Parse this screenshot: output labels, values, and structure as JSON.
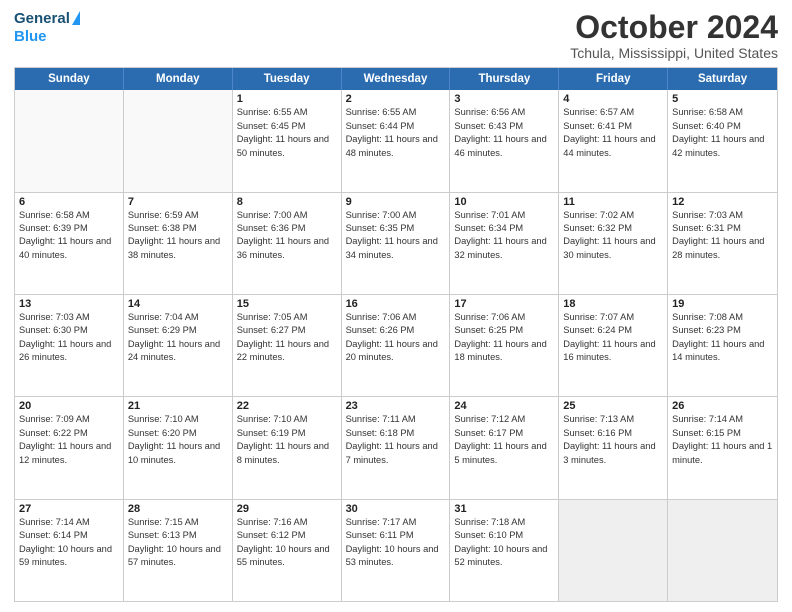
{
  "header": {
    "logo_general": "General",
    "logo_blue": "Blue",
    "month_title": "October 2024",
    "location": "Tchula, Mississippi, United States"
  },
  "weekdays": [
    "Sunday",
    "Monday",
    "Tuesday",
    "Wednesday",
    "Thursday",
    "Friday",
    "Saturday"
  ],
  "weeks": [
    [
      {
        "day": "",
        "info": "",
        "empty": true
      },
      {
        "day": "",
        "info": "",
        "empty": true
      },
      {
        "day": "1",
        "info": "Sunrise: 6:55 AM\nSunset: 6:45 PM\nDaylight: 11 hours and 50 minutes."
      },
      {
        "day": "2",
        "info": "Sunrise: 6:55 AM\nSunset: 6:44 PM\nDaylight: 11 hours and 48 minutes."
      },
      {
        "day": "3",
        "info": "Sunrise: 6:56 AM\nSunset: 6:43 PM\nDaylight: 11 hours and 46 minutes."
      },
      {
        "day": "4",
        "info": "Sunrise: 6:57 AM\nSunset: 6:41 PM\nDaylight: 11 hours and 44 minutes."
      },
      {
        "day": "5",
        "info": "Sunrise: 6:58 AM\nSunset: 6:40 PM\nDaylight: 11 hours and 42 minutes."
      }
    ],
    [
      {
        "day": "6",
        "info": "Sunrise: 6:58 AM\nSunset: 6:39 PM\nDaylight: 11 hours and 40 minutes."
      },
      {
        "day": "7",
        "info": "Sunrise: 6:59 AM\nSunset: 6:38 PM\nDaylight: 11 hours and 38 minutes."
      },
      {
        "day": "8",
        "info": "Sunrise: 7:00 AM\nSunset: 6:36 PM\nDaylight: 11 hours and 36 minutes."
      },
      {
        "day": "9",
        "info": "Sunrise: 7:00 AM\nSunset: 6:35 PM\nDaylight: 11 hours and 34 minutes."
      },
      {
        "day": "10",
        "info": "Sunrise: 7:01 AM\nSunset: 6:34 PM\nDaylight: 11 hours and 32 minutes."
      },
      {
        "day": "11",
        "info": "Sunrise: 7:02 AM\nSunset: 6:32 PM\nDaylight: 11 hours and 30 minutes."
      },
      {
        "day": "12",
        "info": "Sunrise: 7:03 AM\nSunset: 6:31 PM\nDaylight: 11 hours and 28 minutes."
      }
    ],
    [
      {
        "day": "13",
        "info": "Sunrise: 7:03 AM\nSunset: 6:30 PM\nDaylight: 11 hours and 26 minutes."
      },
      {
        "day": "14",
        "info": "Sunrise: 7:04 AM\nSunset: 6:29 PM\nDaylight: 11 hours and 24 minutes."
      },
      {
        "day": "15",
        "info": "Sunrise: 7:05 AM\nSunset: 6:27 PM\nDaylight: 11 hours and 22 minutes."
      },
      {
        "day": "16",
        "info": "Sunrise: 7:06 AM\nSunset: 6:26 PM\nDaylight: 11 hours and 20 minutes."
      },
      {
        "day": "17",
        "info": "Sunrise: 7:06 AM\nSunset: 6:25 PM\nDaylight: 11 hours and 18 minutes."
      },
      {
        "day": "18",
        "info": "Sunrise: 7:07 AM\nSunset: 6:24 PM\nDaylight: 11 hours and 16 minutes."
      },
      {
        "day": "19",
        "info": "Sunrise: 7:08 AM\nSunset: 6:23 PM\nDaylight: 11 hours and 14 minutes."
      }
    ],
    [
      {
        "day": "20",
        "info": "Sunrise: 7:09 AM\nSunset: 6:22 PM\nDaylight: 11 hours and 12 minutes."
      },
      {
        "day": "21",
        "info": "Sunrise: 7:10 AM\nSunset: 6:20 PM\nDaylight: 11 hours and 10 minutes."
      },
      {
        "day": "22",
        "info": "Sunrise: 7:10 AM\nSunset: 6:19 PM\nDaylight: 11 hours and 8 minutes."
      },
      {
        "day": "23",
        "info": "Sunrise: 7:11 AM\nSunset: 6:18 PM\nDaylight: 11 hours and 7 minutes."
      },
      {
        "day": "24",
        "info": "Sunrise: 7:12 AM\nSunset: 6:17 PM\nDaylight: 11 hours and 5 minutes."
      },
      {
        "day": "25",
        "info": "Sunrise: 7:13 AM\nSunset: 6:16 PM\nDaylight: 11 hours and 3 minutes."
      },
      {
        "day": "26",
        "info": "Sunrise: 7:14 AM\nSunset: 6:15 PM\nDaylight: 11 hours and 1 minute."
      }
    ],
    [
      {
        "day": "27",
        "info": "Sunrise: 7:14 AM\nSunset: 6:14 PM\nDaylight: 10 hours and 59 minutes."
      },
      {
        "day": "28",
        "info": "Sunrise: 7:15 AM\nSunset: 6:13 PM\nDaylight: 10 hours and 57 minutes."
      },
      {
        "day": "29",
        "info": "Sunrise: 7:16 AM\nSunset: 6:12 PM\nDaylight: 10 hours and 55 minutes."
      },
      {
        "day": "30",
        "info": "Sunrise: 7:17 AM\nSunset: 6:11 PM\nDaylight: 10 hours and 53 minutes."
      },
      {
        "day": "31",
        "info": "Sunrise: 7:18 AM\nSunset: 6:10 PM\nDaylight: 10 hours and 52 minutes."
      },
      {
        "day": "",
        "info": "",
        "empty": true,
        "shaded": true
      },
      {
        "day": "",
        "info": "",
        "empty": true,
        "shaded": true
      }
    ]
  ]
}
